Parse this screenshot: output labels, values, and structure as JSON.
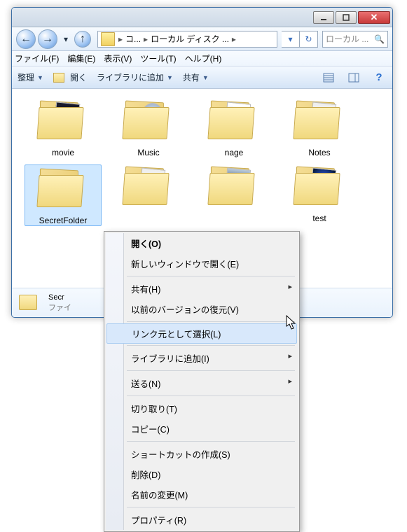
{
  "breadcrumb": {
    "seg1": "コ...",
    "seg2": "ローカル ディスク ..."
  },
  "search": {
    "placeholder": "ローカル ..."
  },
  "menus": {
    "file": "ファイル(F)",
    "edit": "編集(E)",
    "view": "表示(V)",
    "tools": "ツール(T)",
    "help": "ヘルプ(H)"
  },
  "toolbar": {
    "organize": "整理",
    "open": "開く",
    "library": "ライブラリに追加",
    "share": "共有"
  },
  "folders": [
    {
      "name": "movie",
      "thumb": "dark"
    },
    {
      "name": "Music",
      "thumb": "cd"
    },
    {
      "name": "nage",
      "thumb": "note"
    },
    {
      "name": "Notes",
      "thumb": "paper"
    },
    {
      "name": "SecretFolder",
      "thumb": null,
      "selected": true
    },
    {
      "name": "",
      "thumb": "paper"
    },
    {
      "name": "",
      "thumb": "photo"
    },
    {
      "name": "test",
      "thumb": "space"
    }
  ],
  "details": {
    "name": "Secr",
    "type": "ファイ"
  },
  "ctx": {
    "open": "開く(O)",
    "newwin": "新しいウィンドウで開く(E)",
    "share": "共有(H)",
    "restore": "以前のバージョンの復元(V)",
    "linksrc": "リンク元として選択(L)",
    "library": "ライブラリに追加(I)",
    "sendto": "送る(N)",
    "cut": "切り取り(T)",
    "copy": "コピー(C)",
    "shortcut": "ショートカットの作成(S)",
    "delete": "削除(D)",
    "rename": "名前の変更(M)",
    "properties": "プロパティ(R)"
  }
}
